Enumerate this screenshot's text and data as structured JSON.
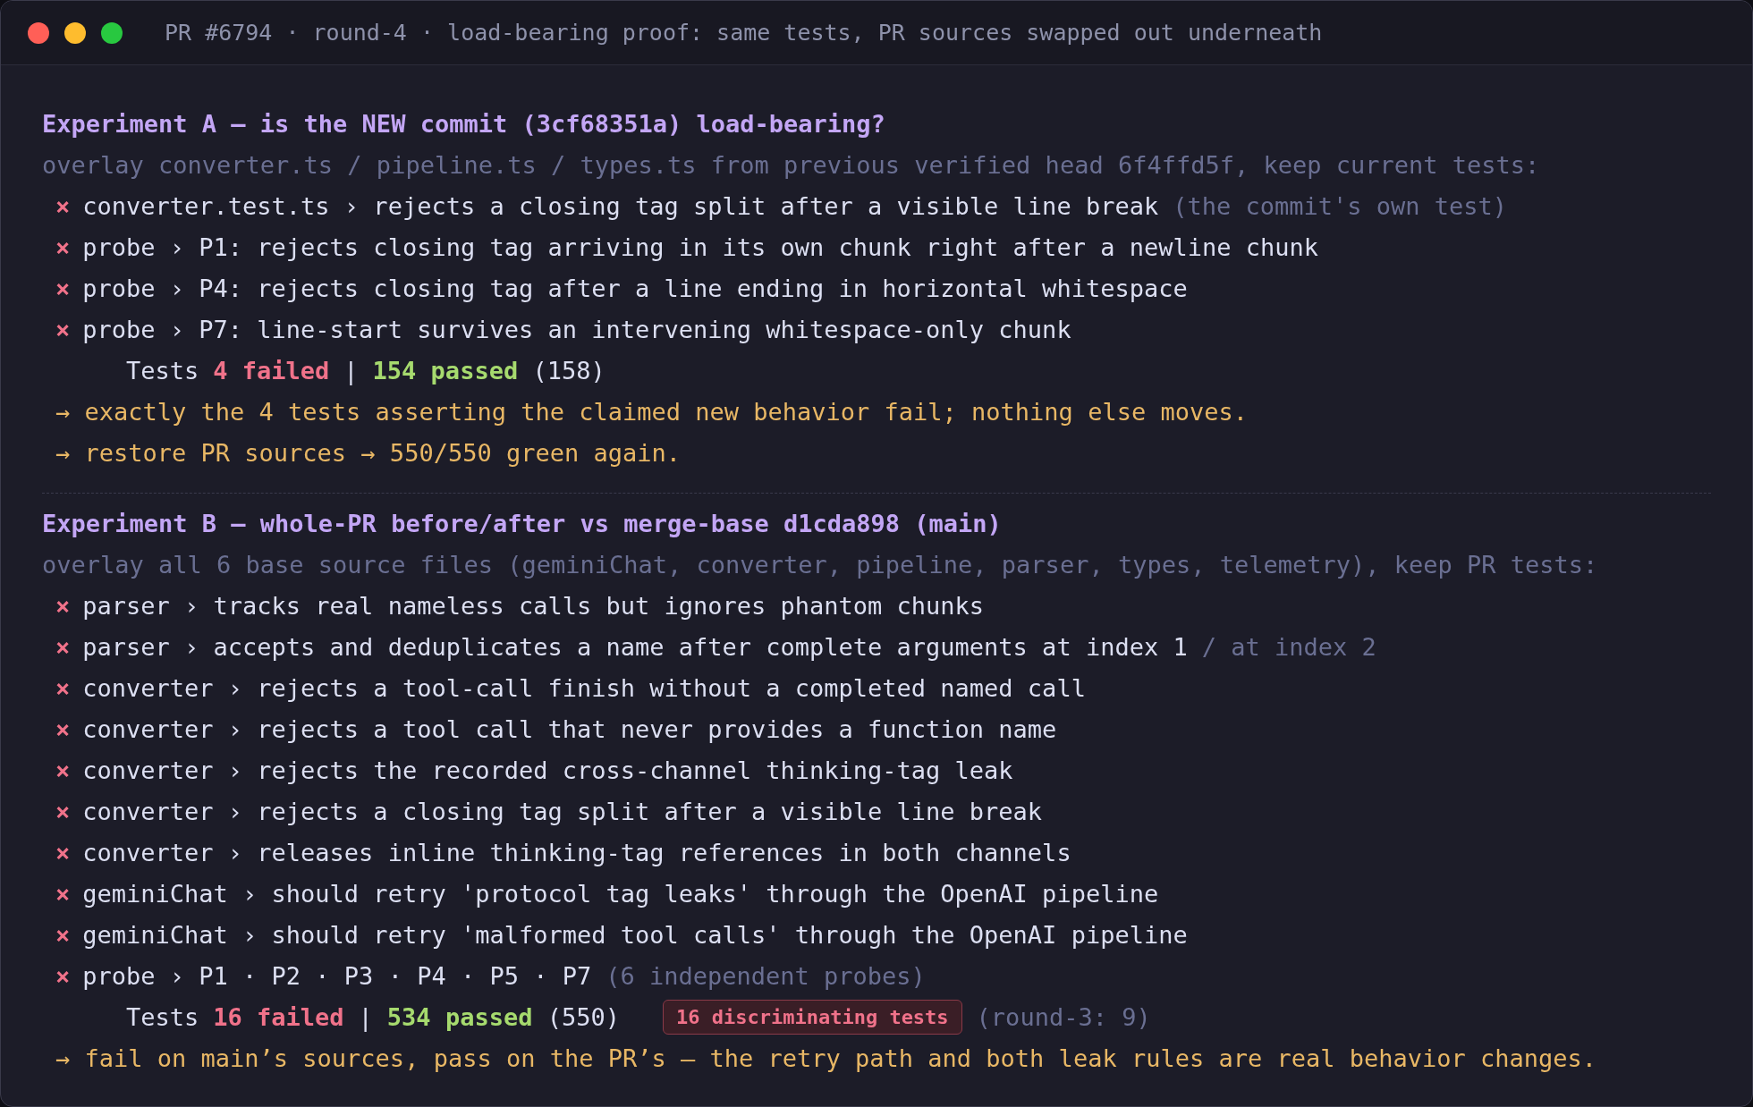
{
  "window": {
    "title": "PR #6794 · round-4 · load-bearing proof: same tests, PR sources swapped out underneath"
  },
  "sections": [
    {
      "heading": "Experiment A — is the NEW commit (3cf68351a) load-bearing?",
      "subheading": "overlay converter.ts / pipeline.ts / types.ts from previous verified head 6f4ffd5f, keep current tests:",
      "results": [
        {
          "marker": "×",
          "text": "converter.test.ts › rejects a closing tag split after a visible line break",
          "note": "(the commit's own test)"
        },
        {
          "marker": "×",
          "text": "probe › P1: rejects closing tag arriving in its own chunk right after a newline chunk"
        },
        {
          "marker": "×",
          "text": "probe › P4: rejects closing tag after a line ending in horizontal whitespace"
        },
        {
          "marker": "×",
          "text": "probe › P7: line-start survives an intervening whitespace-only chunk"
        }
      ],
      "summary": {
        "label": "Tests",
        "failed": "4 failed",
        "separator": "|",
        "passed": "154 passed",
        "total": "(158)"
      },
      "conclusions": [
        "→ exactly the 4 tests asserting the claimed new behavior fail; nothing else moves.",
        "→ restore PR sources → 550/550 green again."
      ]
    },
    {
      "heading": "Experiment B — whole-PR before/after vs merge-base d1cda898 (main)",
      "subheading": "overlay all 6 base source files (geminiChat, converter, pipeline, parser, types, telemetry), keep PR tests:",
      "results": [
        {
          "marker": "×",
          "text": "parser › tracks real nameless calls but ignores phantom chunks"
        },
        {
          "marker": "×",
          "text": "parser › accepts and deduplicates a name after complete arguments at index 1",
          "note": "/ at index 2"
        },
        {
          "marker": "×",
          "text": "converter › rejects a tool-call finish without a completed named call"
        },
        {
          "marker": "×",
          "text": "converter › rejects a tool call that never provides a function name"
        },
        {
          "marker": "×",
          "text": "converter › rejects the recorded cross-channel thinking-tag leak"
        },
        {
          "marker": "×",
          "text": "converter › rejects a closing tag split after a visible line break"
        },
        {
          "marker": "×",
          "text": "converter › releases inline thinking-tag references in both channels"
        },
        {
          "marker": "×",
          "text": "geminiChat › should retry 'protocol tag leaks' through the OpenAI pipeline"
        },
        {
          "marker": "×",
          "text": "geminiChat › should retry 'malformed tool calls' through the OpenAI pipeline"
        },
        {
          "marker": "×",
          "text": "probe › P1 · P2 · P3 · P4 · P5 · P7",
          "note": "(6 independent probes)"
        }
      ],
      "summary": {
        "label": "Tests",
        "failed": "16 failed",
        "separator": "|",
        "passed": "534 passed",
        "total": "(550)",
        "badge": "16 discriminating tests",
        "note": "(round-3: 9)"
      },
      "conclusions": [
        "→ fail on main’s sources, pass on the PR’s — the retry path and both leak rules are real behavior changes."
      ]
    }
  ]
}
